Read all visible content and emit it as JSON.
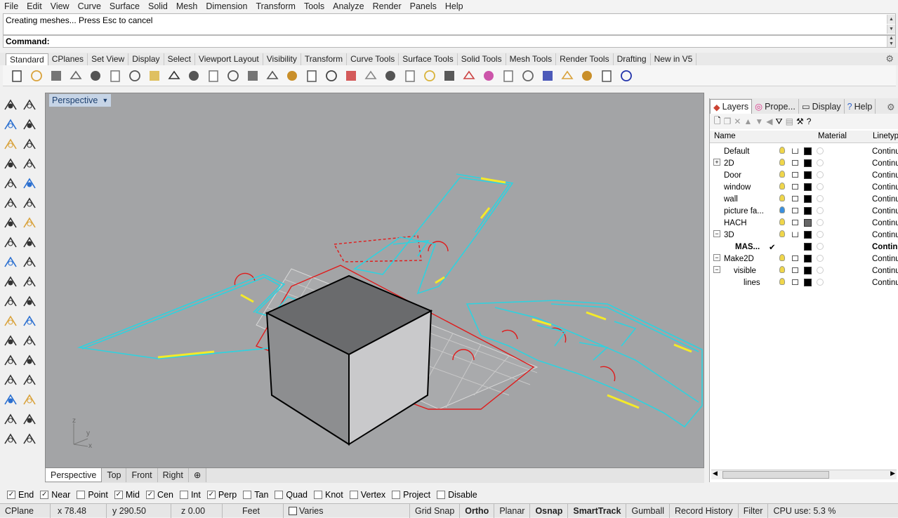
{
  "menu": [
    "File",
    "Edit",
    "View",
    "Curve",
    "Surface",
    "Solid",
    "Mesh",
    "Dimension",
    "Transform",
    "Tools",
    "Analyze",
    "Render",
    "Panels",
    "Help"
  ],
  "command": {
    "history": "Creating meshes... Press Esc to cancel",
    "prompt": "Command:"
  },
  "toolbar_tabs": [
    "Standard",
    "CPlanes",
    "Set View",
    "Display",
    "Select",
    "Viewport Layout",
    "Visibility",
    "Transform",
    "Curve Tools",
    "Surface Tools",
    "Solid Tools",
    "Mesh Tools",
    "Render Tools",
    "Drafting",
    "New in V5"
  ],
  "toolbar_icons": [
    "new-file-icon",
    "open-folder-icon",
    "save-icon",
    "print-icon",
    "import-icon",
    "cut-icon",
    "copy-icon",
    "paste-icon",
    "undo-icon",
    "pan-hand-icon",
    "rotate-view-icon",
    "zoom-icon",
    "zoom-window-icon",
    "zoom-extents-icon",
    "zoom-selected-icon",
    "undo-view-icon",
    "four-viewports-icon",
    "car-icon",
    "grid-plane-icon",
    "cplane-icon",
    "transform-icon",
    "light-icon",
    "lock-icon",
    "object-properties-icon",
    "color-wheel-icon",
    "shaded-icon",
    "rendered-icon",
    "render-sphere-icon",
    "select-filter-icon",
    "options-icon",
    "grid-snap-icon",
    "help-icon"
  ],
  "viewport": {
    "title": "Perspective",
    "axis": {
      "z": "z",
      "y": "y",
      "x": "x"
    }
  },
  "view_tabs": [
    "Perspective",
    "Top",
    "Front",
    "Right"
  ],
  "osnaps": [
    {
      "label": "End",
      "on": true
    },
    {
      "label": "Near",
      "on": true
    },
    {
      "label": "Point",
      "on": false
    },
    {
      "label": "Mid",
      "on": true
    },
    {
      "label": "Cen",
      "on": true
    },
    {
      "label": "Int",
      "on": false
    },
    {
      "label": "Perp",
      "on": true
    },
    {
      "label": "Tan",
      "on": false
    },
    {
      "label": "Quad",
      "on": false
    },
    {
      "label": "Knot",
      "on": false
    },
    {
      "label": "Vertex",
      "on": false
    },
    {
      "label": "Project",
      "on": false
    },
    {
      "label": "Disable",
      "on": false
    }
  ],
  "status": {
    "cplane": "CPlane",
    "x": "x 78.48",
    "y": "y 290.50",
    "z": "z 0.00",
    "units": "Feet",
    "layer": "Varies",
    "grid_snap": "Grid Snap",
    "ortho": "Ortho",
    "planar": "Planar",
    "osnap": "Osnap",
    "smarttrack": "SmartTrack",
    "gumball": "Gumball",
    "record_history": "Record History",
    "filter": "Filter",
    "cpu": "CPU use: 5.3 %"
  },
  "panel": {
    "tabs": [
      "Layers",
      "Prope...",
      "Display",
      "Help"
    ],
    "columns": {
      "name": "Name",
      "material": "Material",
      "linetype": "Linetyp"
    },
    "layers": [
      {
        "name": "Default",
        "linetype": "Continu",
        "bulb": "yellow",
        "lock": "open",
        "swatch": "#000000",
        "expander": ""
      },
      {
        "name": "2D",
        "linetype": "Continu",
        "bulb": "yellow",
        "lock": "closed",
        "swatch": "#000000",
        "expander": "+"
      },
      {
        "name": "Door",
        "linetype": "Continu",
        "bulb": "yellow",
        "lock": "closed",
        "swatch": "#000000",
        "expander": ""
      },
      {
        "name": "window",
        "linetype": "Continu",
        "bulb": "yellow",
        "lock": "closed",
        "swatch": "#000000",
        "expander": ""
      },
      {
        "name": "wall",
        "linetype": "Continu",
        "bulb": "yellow",
        "lock": "closed",
        "swatch": "#000000",
        "expander": ""
      },
      {
        "name": "picture fa...",
        "linetype": "Continu",
        "bulb": "blue",
        "lock": "closed",
        "swatch": "#000000",
        "expander": ""
      },
      {
        "name": "HACH",
        "linetype": "Continu",
        "bulb": "yellow",
        "lock": "closed",
        "swatch": "#666666",
        "expander": ""
      },
      {
        "name": "3D",
        "linetype": "Continu",
        "bulb": "yellow",
        "lock": "open",
        "swatch": "#000000",
        "expander": "−"
      },
      {
        "name": "MAS...",
        "linetype": "Contin",
        "bulb": "",
        "lock": "",
        "swatch": "#000000",
        "expander": "",
        "current": true,
        "check": "✔"
      },
      {
        "name": "Make2D",
        "linetype": "Continu",
        "bulb": "yellow",
        "lock": "closed",
        "swatch": "#000000",
        "expander": "−"
      },
      {
        "name": "visible",
        "linetype": "Continu",
        "bulb": "yellow",
        "lock": "closed",
        "swatch": "#000000",
        "expander": "−"
      },
      {
        "name": "lines",
        "linetype": "Continu",
        "bulb": "yellow",
        "lock": "closed",
        "swatch": "#000000",
        "expander": ""
      }
    ]
  }
}
